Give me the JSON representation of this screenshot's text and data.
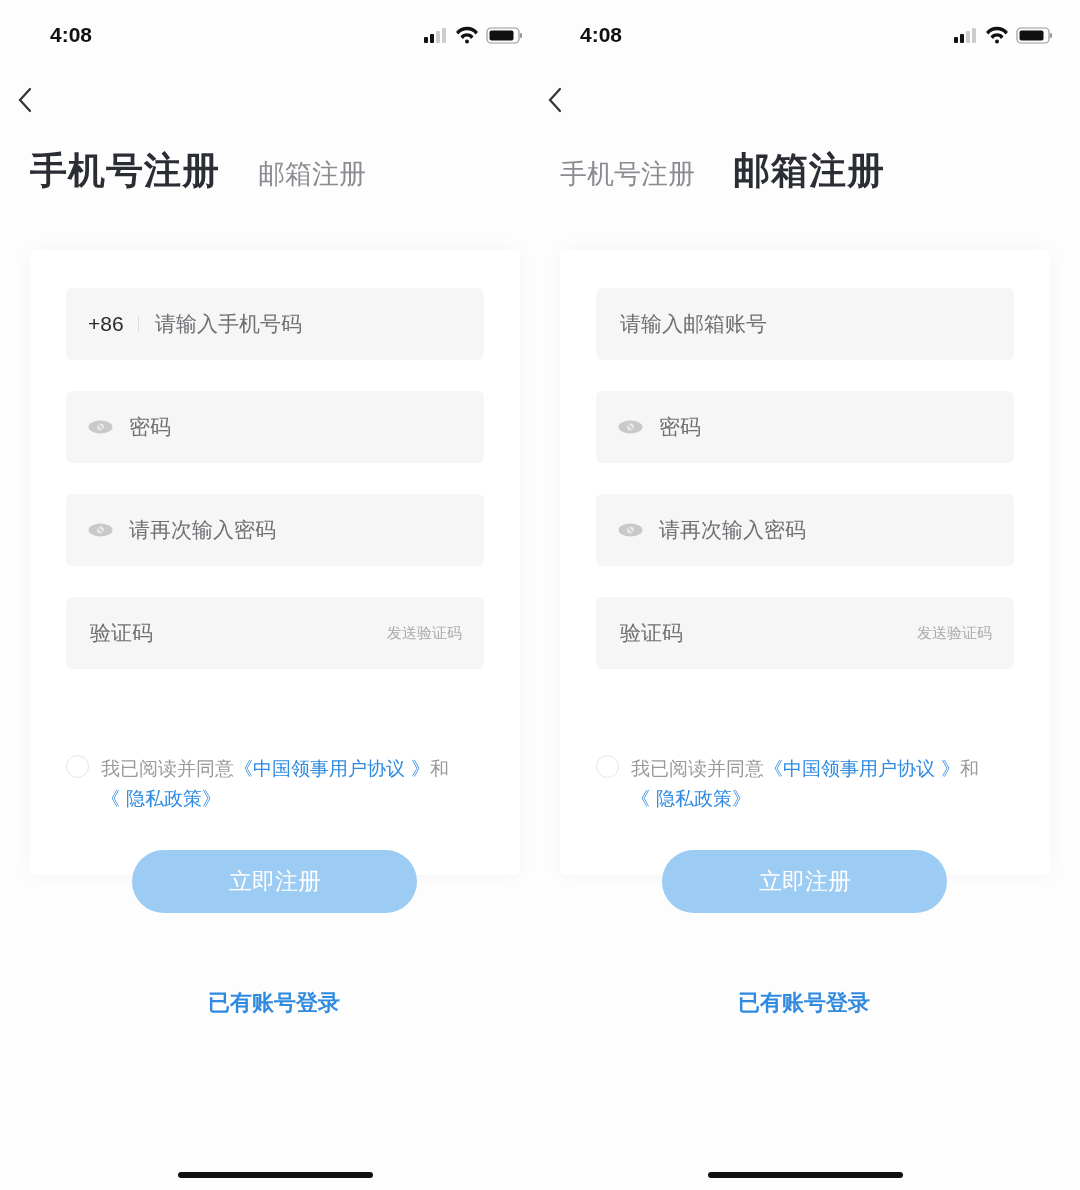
{
  "screens": [
    {
      "status_bar": {
        "time": "4:08"
      },
      "tabs": [
        {
          "label": "手机号注册",
          "selected": true
        },
        {
          "label": "邮箱注册",
          "selected": false
        }
      ],
      "fields": [
        {
          "kind": "phone",
          "prefix": "+86",
          "placeholder": "请输入手机号码"
        },
        {
          "kind": "password",
          "placeholder": "密码"
        },
        {
          "kind": "password",
          "placeholder": "请再次输入密码"
        },
        {
          "kind": "code",
          "placeholder": "验证码",
          "action": "发送验证码"
        }
      ],
      "agreement": {
        "checked": false,
        "parts": [
          {
            "kind": "text",
            "text": "我已阅读并同意"
          },
          {
            "kind": "link",
            "text": "《中国领事用户协议 》"
          },
          {
            "kind": "text",
            "text": "和"
          },
          {
            "kind": "link",
            "text": "《 隐私政策》"
          }
        ]
      },
      "register_button": {
        "label": "立即注册",
        "disabled": true
      },
      "login_link": "已有账号登录"
    },
    {
      "status_bar": {
        "time": "4:08"
      },
      "tabs": [
        {
          "label": "手机号注册",
          "selected": false
        },
        {
          "label": "邮箱注册",
          "selected": true
        }
      ],
      "fields": [
        {
          "kind": "text",
          "placeholder": "请输入邮箱账号"
        },
        {
          "kind": "password",
          "placeholder": "密码"
        },
        {
          "kind": "password",
          "placeholder": "请再次输入密码"
        },
        {
          "kind": "code",
          "placeholder": "验证码",
          "action": "发送验证码"
        }
      ],
      "agreement": {
        "checked": false,
        "parts": [
          {
            "kind": "text",
            "text": "我已阅读并同意"
          },
          {
            "kind": "link",
            "text": "《中国领事用户协议 》"
          },
          {
            "kind": "text",
            "text": "和"
          },
          {
            "kind": "link",
            "text": "《 隐私政策》"
          }
        ]
      },
      "register_button": {
        "label": "立即注册",
        "disabled": true
      },
      "login_link": "已有账号登录"
    }
  ]
}
